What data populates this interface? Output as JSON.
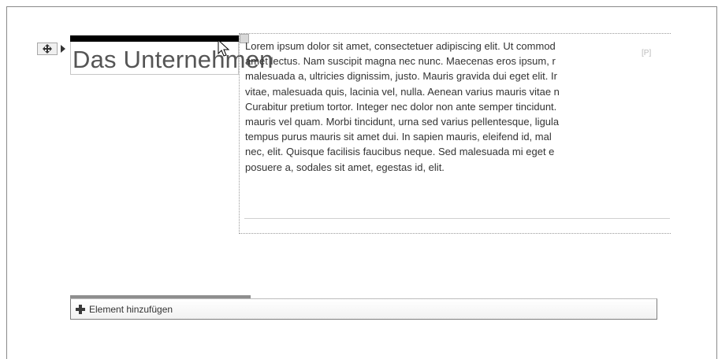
{
  "heading": {
    "text": "Das Unternehmen"
  },
  "ghost": {
    "text": "rimen",
    "corner": "[P]"
  },
  "paragraph": {
    "lines": [
      "Lorem ipsum dolor sit amet, consectetuer adipiscing elit. Ut commod",
      "amet lectus. Nam suscipit magna nec nunc. Maecenas eros ipsum, r",
      "malesuada a, ultricies dignissim, justo. Mauris gravida dui eget elit. Ir",
      "vitae, malesuada quis, lacinia vel, nulla. Aenean varius mauris vitae n",
      "Curabitur pretium tortor. Integer nec dolor non ante semper tincidunt.",
      "mauris vel quam. Morbi tincidunt, urna sed varius pellentesque, ligula",
      "tempus purus mauris sit amet dui. In sapien mauris, eleifend id, mal",
      "nec, elit. Quisque facilisis faucibus neque. Sed malesuada mi eget e",
      "posuere a, sodales sit amet, egestas id, elit."
    ]
  },
  "toolbar": {
    "add_element_label": "Element hinzufügen"
  },
  "icons": {
    "move": "move-arrows-icon",
    "expand": "triangle-right-icon",
    "cursor": "mouse-pointer-icon",
    "add": "plus-icon"
  }
}
